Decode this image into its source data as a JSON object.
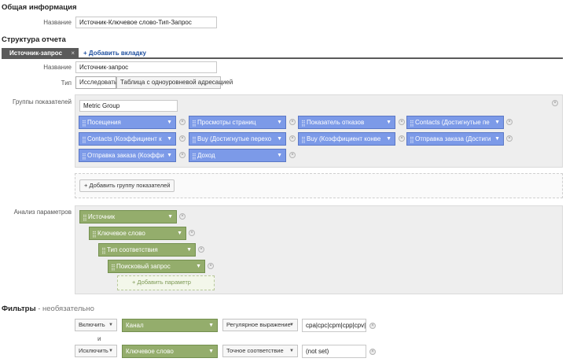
{
  "general": {
    "heading": "Общая информация",
    "name_label": "Название",
    "name_value": "Источник-Ключевое слово-Тип-Запрос"
  },
  "structure": {
    "heading": "Структура отчета",
    "tab_label": "Источник-запрос",
    "tab_close": "×",
    "add_tab": "+ Добавить вкладку",
    "name_label": "Название",
    "name_value": "Источник-запрос",
    "type_label": "Тип",
    "type_options": [
      "Исследовать",
      "Таблица с одноуровневой адресацией"
    ]
  },
  "metric_groups": {
    "label": "Группы показателей",
    "group_name": "Metric Group",
    "metrics": [
      "Посещения",
      "Просмотры страниц",
      "Показатель отказов",
      "Contacts (Достигнутые пе",
      "Contacts (Коэффициент к",
      "Buy (Достигнутые перехо",
      "Buy (Коэффициент конве",
      "Отправка заказа (Достиги",
      "Отправка заказа (Коэффи",
      "Доход"
    ],
    "add_group": "+ Добавить группу показателей"
  },
  "dimensions": {
    "label": "Анализ параметров",
    "items": [
      "Источник",
      "Ключевое слово",
      "Тип соответствия",
      "Поисковый запрос"
    ],
    "add_param": "+ Добавить параметр"
  },
  "filters": {
    "heading": "Фильтры",
    "optional": " - необязательно",
    "connector": "и",
    "rows": [
      {
        "mode": "Включить",
        "dimension": "Канал",
        "match": "Регулярное выражение",
        "value": "cpa|cpc|cpm|cpp|cpv|pc"
      },
      {
        "mode": "Исключить",
        "dimension": "Ключевое слово",
        "match": "Точное соответствие",
        "value": "(not set)"
      }
    ]
  },
  "icons": {
    "caret": "▼",
    "grip": "⣿",
    "remove": "×"
  }
}
